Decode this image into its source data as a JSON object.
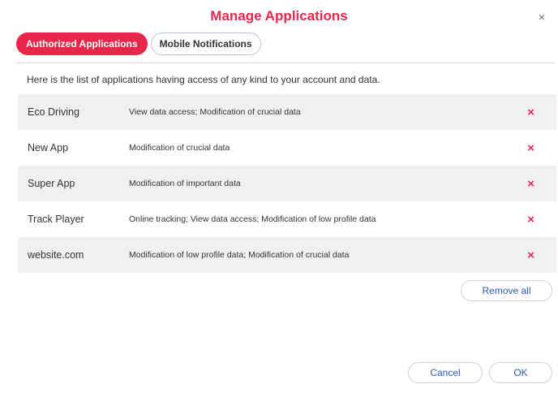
{
  "dialog": {
    "title": "Manage Applications",
    "close_label": "×"
  },
  "tabs": [
    {
      "label": "Authorized Applications",
      "active": true
    },
    {
      "label": "Mobile Notifications",
      "active": false
    }
  ],
  "intro_text": "Here is the list of applications having access of any kind to your account and data.",
  "applications": [
    {
      "name": "Eco Driving",
      "permissions": "View data access; Modification of crucial data",
      "remove_icon": "×"
    },
    {
      "name": "New App",
      "permissions": "Modification of crucial data",
      "remove_icon": "×"
    },
    {
      "name": "Super App",
      "permissions": "Modification of important data",
      "remove_icon": "×"
    },
    {
      "name": "Track Player",
      "permissions": "Online tracking; View data access; Modification of low profile data",
      "remove_icon": "×"
    },
    {
      "name": "website.com",
      "permissions": "Modification of low profile data; Modification of crucial data",
      "remove_icon": "×"
    }
  ],
  "buttons": {
    "remove_all": "Remove all",
    "cancel": "Cancel",
    "ok": "OK"
  },
  "colors": {
    "accent": "#e8274b",
    "link_blue": "#2a5db0",
    "row_shade": "#f0f0f0"
  }
}
